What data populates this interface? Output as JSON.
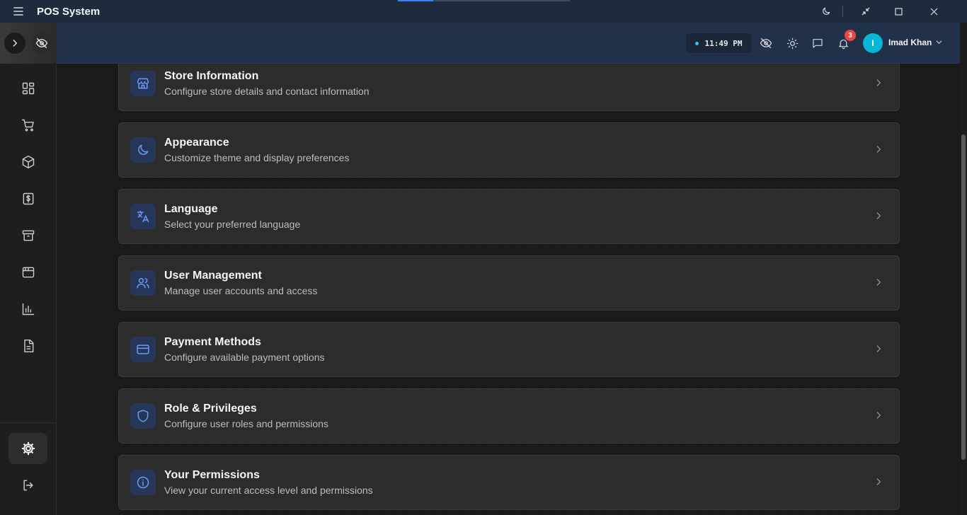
{
  "app": {
    "title": "POS System"
  },
  "header": {
    "time": "11:49 PM",
    "notification_count": "3",
    "user_initial": "I",
    "user_name": "Imad Khan"
  },
  "settings": [
    {
      "title": "Store Information",
      "desc": "Configure store details and contact information",
      "icon": "store-icon"
    },
    {
      "title": "Appearance",
      "desc": "Customize theme and display preferences",
      "icon": "moon-icon"
    },
    {
      "title": "Language",
      "desc": "Select your preferred language",
      "icon": "translate-icon"
    },
    {
      "title": "User Management",
      "desc": "Manage user accounts and access",
      "icon": "users-icon"
    },
    {
      "title": "Payment Methods",
      "desc": "Configure available payment options",
      "icon": "credit-card-icon"
    },
    {
      "title": "Role & Privileges",
      "desc": "Configure user roles and permissions",
      "icon": "shield-icon"
    },
    {
      "title": "Your Permissions",
      "desc": "View your current access level and permissions",
      "icon": "info-icon"
    }
  ],
  "sidebar": {
    "icons": [
      "dashboard-icon",
      "cart-icon",
      "box-icon",
      "dollar-icon",
      "archive-icon",
      "browser-icon",
      "bar-chart-icon",
      "document-icon",
      "settings-icon",
      "logout-icon"
    ]
  }
}
